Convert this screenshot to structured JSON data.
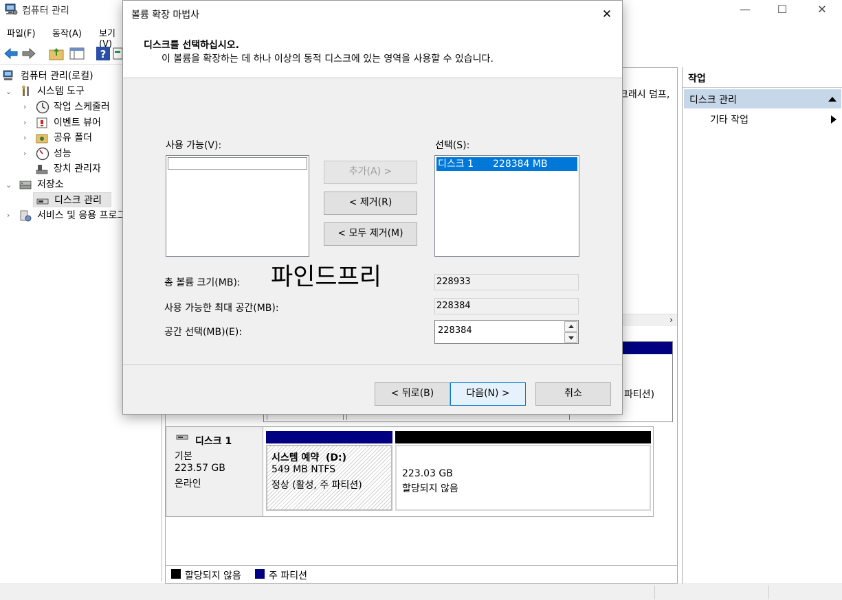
{
  "window": {
    "title": "컴퓨터 관리",
    "minimize": "—",
    "maximize": "☐",
    "close": "✕"
  },
  "menu": [
    "파일(F)",
    "동작(A)",
    "보기(V)"
  ],
  "tree": {
    "root": "컴퓨터 관리(로컬)",
    "system_tools": "시스템 도구",
    "task_scheduler": "작업 스케줄러",
    "event_viewer": "이벤트 뷰어",
    "shared_folders": "공유 폴더",
    "performance": "성능",
    "device_manager": "장치 관리자",
    "storage": "저장소",
    "disk_management": "디스크 관리",
    "services_apps": "서비스 및 응용 프로그램"
  },
  "center": {
    "crash_dump_fragment": "크래시 덤프,",
    "partition_fragment": "파티션)",
    "disk1": {
      "name": "디스크 1",
      "type": "기본",
      "size": "223.57 GB",
      "status": "온라인"
    },
    "part_system": {
      "name": "시스템 예약",
      "letter": "(D:)",
      "size": "549 MB NTFS",
      "status": "정상 (활성, 주 파티션)"
    },
    "part_unalloc": {
      "size": "223.03 GB",
      "status": "할당되지 않음"
    },
    "legend": {
      "unallocated": "할당되지 않음",
      "primary": "주 파티션"
    }
  },
  "actions": {
    "header": "작업",
    "section": "디스크 관리",
    "more": "기타 작업"
  },
  "dialog": {
    "title": "볼륨 확장 마법사",
    "heading": "디스크를 선택하십시오.",
    "subheading": "이 볼륨을 확장하는 데 하나 이상의 동적 디스크에 있는 영역을 사용할 수 있습니다.",
    "available_label": "사용 가능(V):",
    "selected_label": "선택(S):",
    "selected_items": [
      {
        "disk": "디스크 1",
        "size": "228384 MB"
      }
    ],
    "add_button": "추가(A) >",
    "remove_button": "< 제거(R)",
    "remove_all_button": "< 모두 제거(M)",
    "watermark": "파인드프리",
    "total_label": "총 볼륨 크기(MB):",
    "total_value": "228933",
    "max_label": "사용 가능한 최대 공간(MB):",
    "max_value": "228384",
    "select_label": "공간 선택(MB)(E):",
    "select_value": "228384",
    "back_button": "< 뒤로(B)",
    "next_button": "다음(N) >",
    "cancel_button": "취소"
  },
  "colors": {
    "primary_partition": "#000080",
    "unallocated": "#000000",
    "selection": "#0078d7",
    "actions_section_bg": "#c7d7ea"
  }
}
